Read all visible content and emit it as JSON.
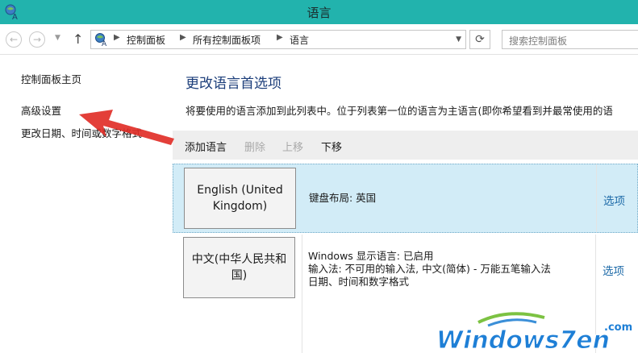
{
  "window": {
    "title": "语言"
  },
  "address_bar": {
    "crumbs": [
      "控制面板",
      "所有控制面板项",
      "语言"
    ],
    "search_placeholder": "搜索控制面板"
  },
  "left_nav": {
    "items": [
      "控制面板主页",
      "高级设置",
      "更改日期、时间或数字格式"
    ]
  },
  "main": {
    "heading": "更改语言首选项",
    "description": "将要使用的语言添加到此列表中。位于列表第一位的语言为主语言(即你希望看到并最常使用的语",
    "toolbar": {
      "add": "添加语言",
      "remove": "删除",
      "up": "上移",
      "down": "下移"
    },
    "languages": [
      {
        "name": "English (United Kingdom)",
        "details": [
          "键盘布局: 英国"
        ],
        "options": "选项"
      },
      {
        "name": "中文(中华人民共和国)",
        "details": [
          "Windows 显示语言: 已启用",
          "输入法: 不可用的输入法, 中文(简体) - 万能五笔输入法",
          "日期、时间和数字格式"
        ],
        "options": "选项"
      }
    ]
  },
  "watermark": {
    "brand": "Windows7en",
    "domain": ".com"
  },
  "colors": {
    "titlebar": "#22b3ad",
    "selected_row": "#d2ecf7",
    "link": "#1d6aa8",
    "heading": "#1c3e7a",
    "annotation_arrow": "#e02a24"
  }
}
